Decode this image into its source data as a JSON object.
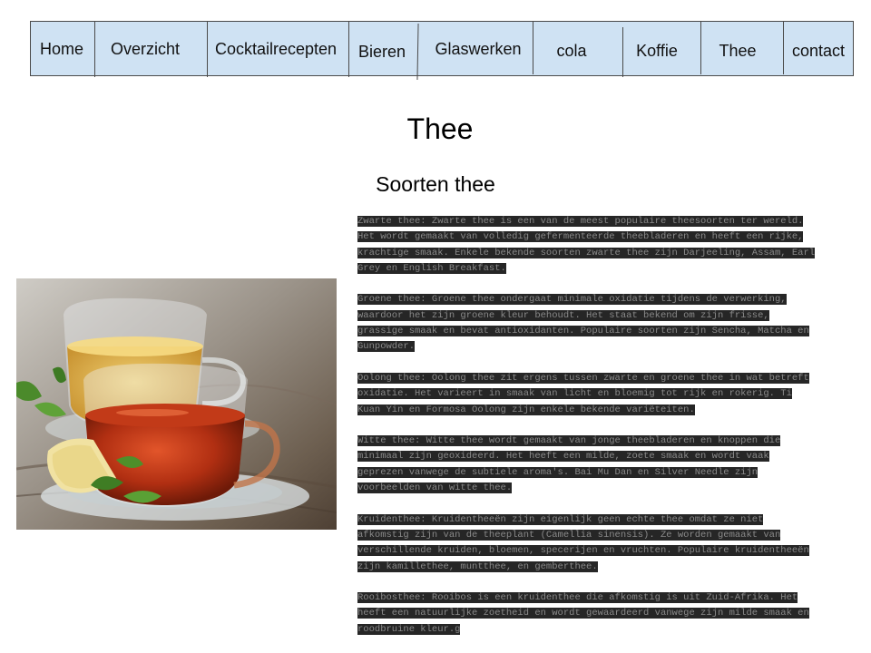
{
  "nav": {
    "items": [
      {
        "label": "Home"
      },
      {
        "label": "Overzicht"
      },
      {
        "label": "Cocktailrecepten"
      },
      {
        "label": "Bieren"
      },
      {
        "label": "Glaswerken"
      },
      {
        "label": "cola"
      },
      {
        "label": "Koffie"
      },
      {
        "label": "Thee"
      },
      {
        "label": "contact"
      }
    ]
  },
  "page": {
    "title": "Thee",
    "section_title": "Soorten thee"
  },
  "image": {
    "subject": "tea-cups-with-lemon-and-mint"
  },
  "paragraphs": [
    "Zwarte thee: Zwarte thee is een van de meest populaire theesoorten ter wereld. Het wordt gemaakt van volledig gefermenteerde theebladeren en heeft een rijke, krachtige smaak. Enkele bekende soorten zwarte thee zijn Darjeeling, Assam, Earl Grey en English Breakfast.",
    "Groene thee: Groene thee ondergaat minimale oxidatie tijdens de verwerking, waardoor het zijn groene kleur behoudt. Het staat bekend om zijn frisse, grassige smaak en bevat antioxidanten. Populaire soorten zijn Sencha, Matcha en Gunpowder.",
    "Oolong thee: Oolong thee zit ergens tussen zwarte en groene thee in wat betreft oxidatie. Het varieert in smaak van licht en bloemig tot rijk en rokerig. Ti Kuan Yin en Formosa Oolong zijn enkele bekende variëteiten.",
    "Witte thee: Witte thee wordt gemaakt van jonge theebladeren en knoppen die minimaal zijn geoxideerd. Het heeft een milde, zoete smaak en wordt vaak geprezen vanwege de subtiele aroma's. Bai Mu Dan en Silver Needle zijn voorbeelden van witte thee.",
    "Kruidenthee: Kruidentheeën zijn eigenlijk geen echte thee omdat ze niet afkomstig zijn van de theeplant (Camellia sinensis). Ze worden gemaakt van verschillende kruiden, bloemen, specerijen en vruchten. Populaire kruidentheeën zijn kamillethee, muntthee, en gemberthee.",
    "Rooibosthee: Rooibos is een kruidenthee die afkomstig is uit Zuid-Afrika. Het heeft een natuurlijke zoetheid en wordt gewaardeerd vanwege zijn milde smaak en roodbruine kleur.g"
  ]
}
